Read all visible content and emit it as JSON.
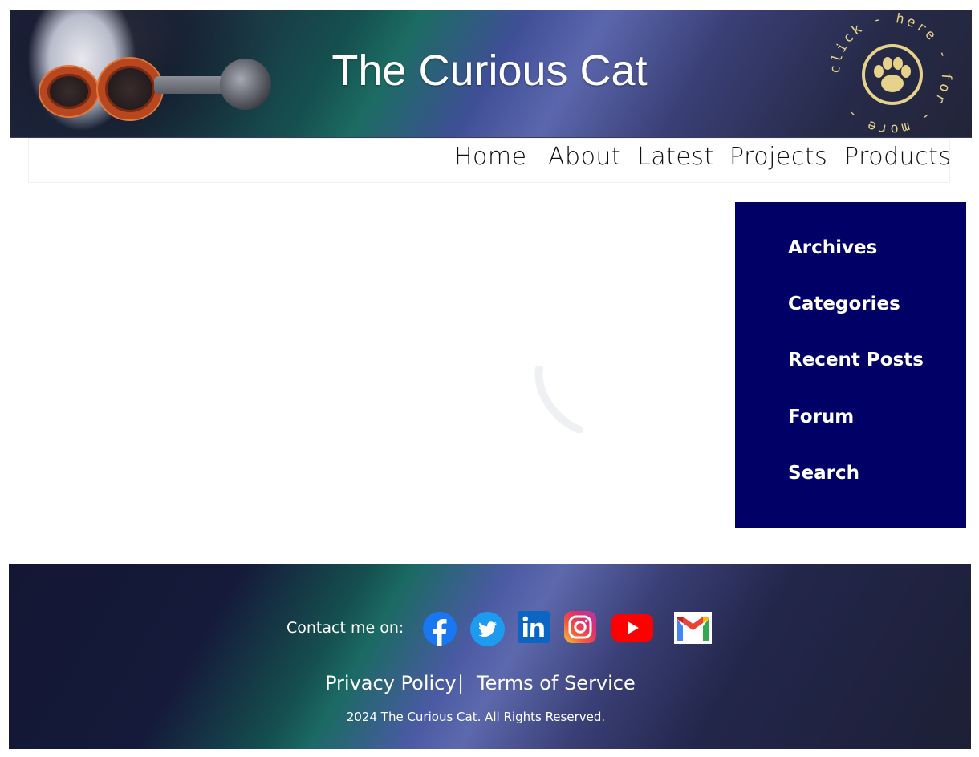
{
  "header": {
    "title": "The Curious Cat",
    "logo_ring_text": "click - here - for - more -"
  },
  "nav": {
    "items": [
      {
        "label": "Home"
      },
      {
        "label": "About"
      },
      {
        "label": "Latest"
      },
      {
        "label": "Projects"
      },
      {
        "label": "Products"
      }
    ]
  },
  "sidebar": {
    "background_color": "#000066",
    "items": [
      {
        "label": "Archives"
      },
      {
        "label": "Categories"
      },
      {
        "label": "Recent Posts"
      },
      {
        "label": "Forum"
      },
      {
        "label": "Search"
      }
    ]
  },
  "footer": {
    "contact_label": "Contact me on:",
    "social": [
      {
        "name": "facebook-icon",
        "color": "#1877f2"
      },
      {
        "name": "twitter-icon",
        "color": "#1d9bf0"
      },
      {
        "name": "linkedin-icon",
        "color": "#0a66c2"
      },
      {
        "name": "instagram-icon",
        "color": "#e1306c"
      },
      {
        "name": "youtube-icon",
        "color": "#ff0000"
      },
      {
        "name": "gmail-icon",
        "color": "#ea4335"
      }
    ],
    "privacy_label": "Privacy Policy",
    "separator": "|",
    "terms_label": "Terms of Service",
    "copyright": "2024 The Curious Cat. All Rights Reserved."
  },
  "colors": {
    "banner_accent": "#5b67ad",
    "logo_gold": "#e6d28a"
  }
}
